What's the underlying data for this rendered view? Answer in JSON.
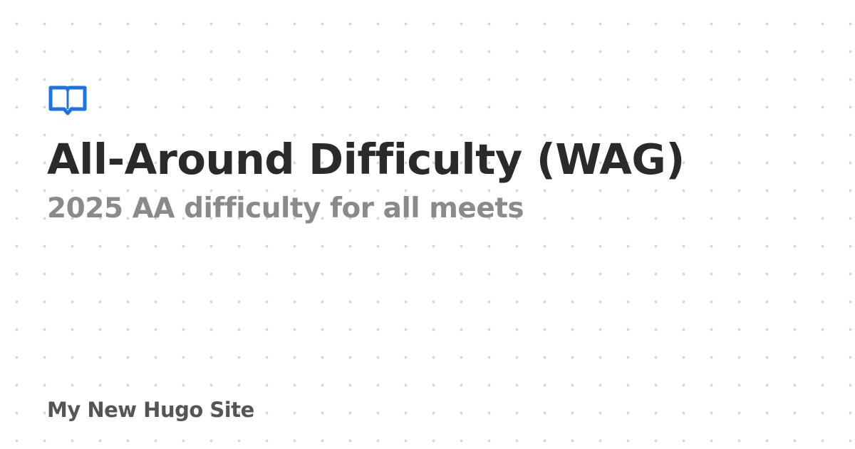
{
  "card": {
    "logo_icon": "open-book-icon",
    "title": "All-Around Difficulty (WAG)",
    "subtitle": "2025 AA difficulty for all meets",
    "site_name": "My New Hugo Site"
  },
  "colors": {
    "accent": "#1a73e8",
    "title": "#2a2a2a",
    "subtitle": "#8a8a8a",
    "site_name": "#555555",
    "background": "#ffffff",
    "dot_pattern": "#d4d4d4"
  }
}
